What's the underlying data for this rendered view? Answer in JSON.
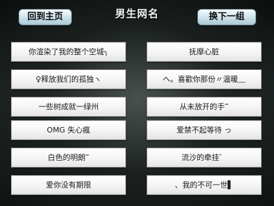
{
  "header": {
    "title": "男生网名",
    "home_button": "回到主页",
    "next_button": "换下一组"
  },
  "names": {
    "left": [
      "你渲染了我的整个空城╮",
      "♀释放我们的孤独ヽ",
      "一些树成就一绿州",
      "OMG 失心瘋",
      "白色的明朗‴",
      "爱你没有期限"
    ],
    "right": [
      "抚摩心脏",
      "ヘ。喜歡你那份〃温暖﹏",
      "从未放开的手‴",
      "爱禁不起等待 っ",
      "流沙的牵挂゛",
      "、我的不可一世▌"
    ]
  }
}
